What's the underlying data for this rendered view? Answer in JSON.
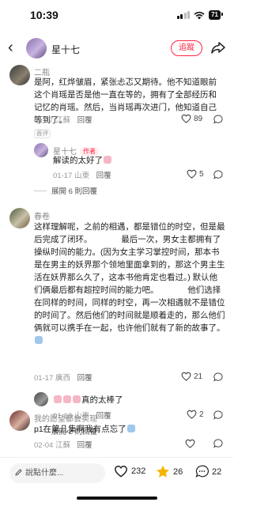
{
  "status_bar": {
    "time": "10:39",
    "battery": "71"
  },
  "nav": {
    "back": "‹",
    "user_name": "星十七",
    "follow_label": "追蹤"
  },
  "comments": [
    {
      "user": "二瓶",
      "text": "是阿，红烨皱眉，紧张忐忑又期待。他不知道眼前这个肖瑶是否是他一直在等的，拥有了全部经历和记忆的肖瑶。然后，当肖瑶再次进门，他知道自己等到了。",
      "date": "01-17",
      "location": "江蘇",
      "reply": "回覆",
      "likes": "89",
      "tag": "首评",
      "replies": [
        {
          "user": "星十七",
          "author_tag": "作者",
          "text": "解读的太好了",
          "date": "01-17",
          "location": "山東",
          "reply": "回覆",
          "likes": "5"
        }
      ],
      "expand": "展開 6 則回覆"
    },
    {
      "user": "春卷",
      "text": "这样理解呢，之前的相遇，都是错位的时空，但是最后完成了闭环。　　　　最后一次，男女主都拥有了操纵时间的能力。(因为女主学习掌控时间，那本书是在男主的妖界那个领地里面拿到的，那这个男主生活在妖界那么久了，这本书他肯定也看过。) 默认他们俩最后都有超控时间的能力吧。　　　　他们选择在同样的时间，同样的时空，再一次相遇就不是错位的时间了。然后他们的时间就是顺着走的，那么他们俩就可以携手在一起，也许他们就有了新的故事了。",
      "date": "01-17",
      "location": "廣西",
      "reply": "回覆",
      "likes": "21",
      "replies": [
        {
          "user": "",
          "text": "真的太棒了",
          "date": "01-18",
          "location": "山東",
          "reply": "回覆",
          "likes": "2"
        }
      ],
      "expand": "展開 2 則回覆"
    },
    {
      "user": "我的愿望都会实现",
      "text": "p1在第几集啊我有点忘了",
      "date": "02-04",
      "location": "江蘇",
      "reply": "回覆"
    }
  ],
  "bottom_bar": {
    "placeholder": "說點什麼...",
    "likes": "232",
    "stars": "26",
    "comments": "22"
  },
  "colors": {
    "accent": "#ff2442",
    "star": "#f5b400"
  }
}
